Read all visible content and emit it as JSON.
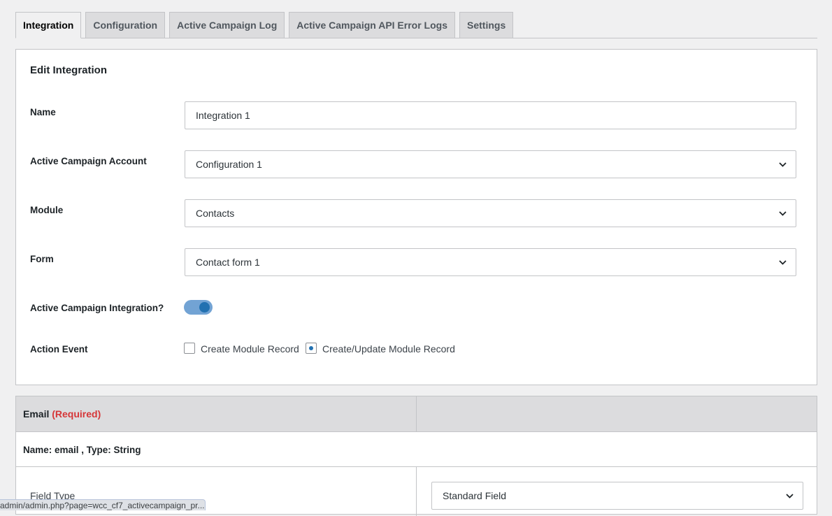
{
  "tabs": [
    {
      "label": "Integration",
      "active": true
    },
    {
      "label": "Configuration",
      "active": false
    },
    {
      "label": "Active Campaign Log",
      "active": false
    },
    {
      "label": "Active Campaign API Error Logs",
      "active": false
    },
    {
      "label": "Settings",
      "active": false
    }
  ],
  "edit": {
    "title": "Edit Integration",
    "name_label": "Name",
    "name_value": "Integration 1",
    "account_label": "Active Campaign Account",
    "account_value": "Configuration 1",
    "module_label": "Module",
    "module_value": "Contacts",
    "form_label": "Form",
    "form_value": "Contact form 1",
    "integration_label": "Active Campaign Integration?",
    "integration_enabled": true,
    "action_label": "Action Event",
    "action_options": [
      {
        "label": "Create Module Record",
        "selected": false
      },
      {
        "label": "Create/Update Module Record",
        "selected": true
      }
    ]
  },
  "mapping": {
    "field_title": "Email",
    "required_label": "(Required)",
    "meta": "Name: email , Type: String",
    "field_type_label": "Field Type",
    "field_type_value": "Standard Field"
  },
  "status_url": "admin/admin.php?page=wcc_cf7_activecampaign_pr...",
  "colors": {
    "accent": "#2271b1",
    "toggle_track": "#72a3d4",
    "required": "#d63638",
    "header_bg": "#dcdcde"
  }
}
